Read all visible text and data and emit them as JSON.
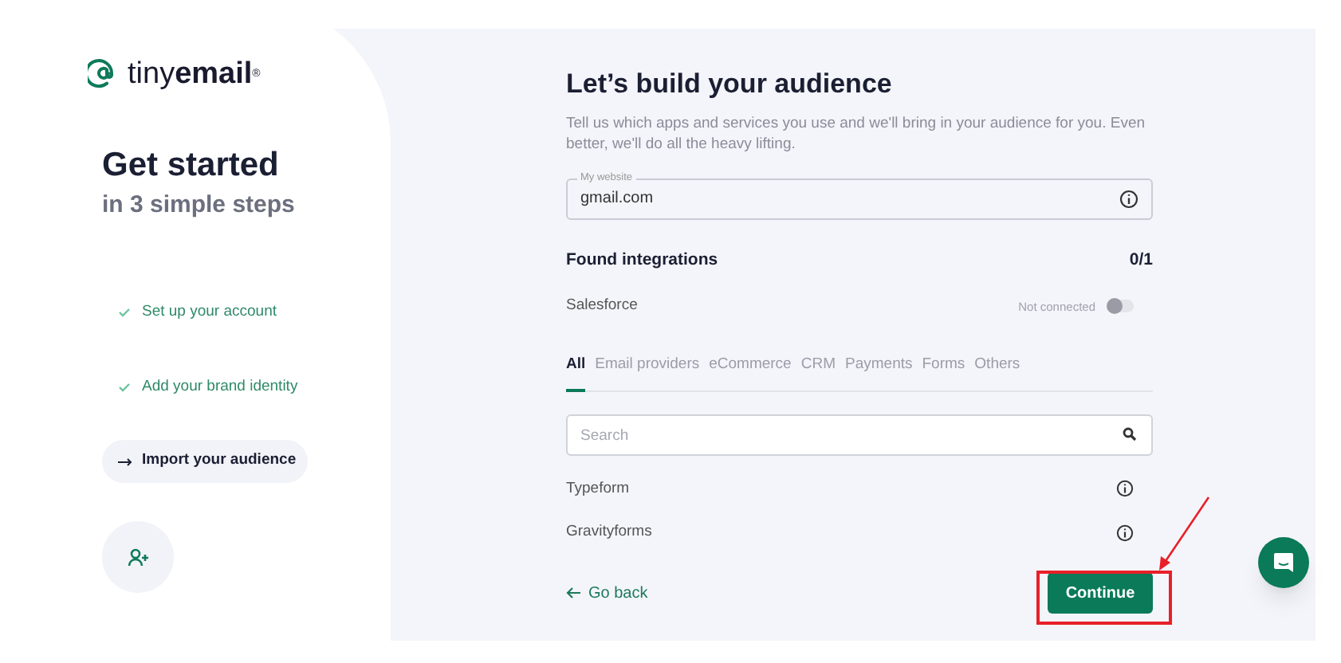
{
  "logo": {
    "text": "tiny**email**$^{®}$"
  },
  "heading": {
    "title": "Get started",
    "subtitle": "in 3 simple steps"
  },
  "steps": [
    {
      "label": "Set up your account",
      "kind": "done"
    },
    {
      "label": "Add your brand identity",
      "kind": "done"
    },
    {
      "label": "Import your audience",
      "kind": "current"
    }
  ],
  "main": {
    "title": "Let’s build your audience",
    "description": "Tell us which apps and services you use and we'll bring in your audience for you. Even better, we'll do all the heavy lifting.",
    "website_field": {
      "label": "My website",
      "value": "gmail.com"
    },
    "found": {
      "title": "Found integrations",
      "count": "0/1",
      "items": [
        {
          "name": "Salesforce",
          "status": "Not connected",
          "on": false
        }
      ]
    },
    "tabs": [
      {
        "label": "All",
        "selected": true
      },
      {
        "label": "Email providers",
        "selected": false
      },
      {
        "label": "eCommerce",
        "selected": false
      },
      {
        "label": "CRM",
        "selected": false
      },
      {
        "label": "Payments",
        "selected": false
      },
      {
        "label": "Forms",
        "selected": false
      },
      {
        "label": "Others",
        "selected": false
      }
    ],
    "search": {
      "placeholder": "Search"
    },
    "integrations": [
      {
        "name": "Typeform"
      },
      {
        "name": "Gravityforms"
      }
    ],
    "back": "Go back",
    "continue": "Continue"
  }
}
